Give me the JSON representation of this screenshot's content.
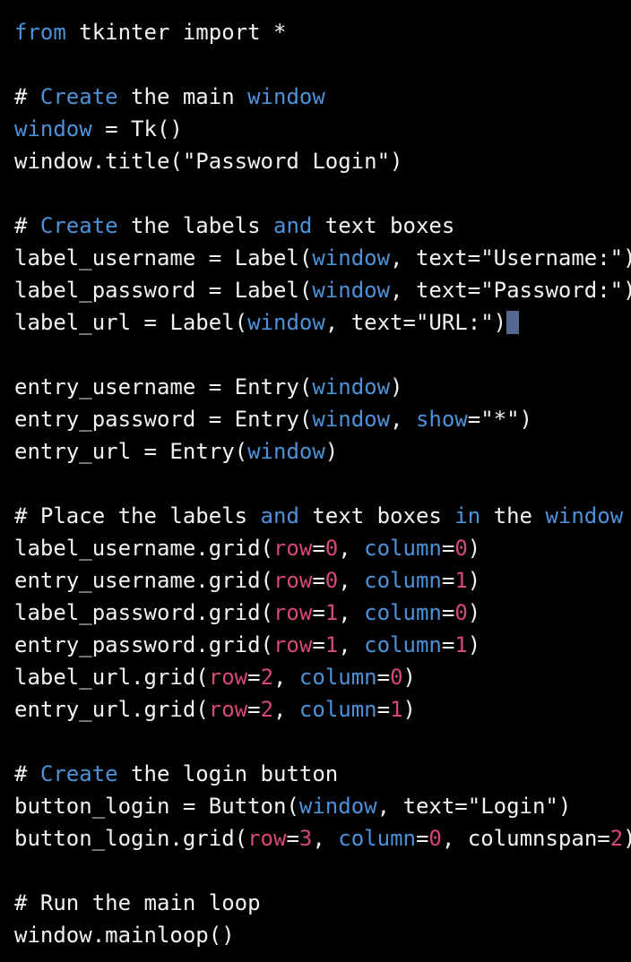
{
  "editor": {
    "background_color": "#000000",
    "font_size_px": 24,
    "line_height_px": 36,
    "colors": {
      "text": "#f2f2f2",
      "keyword_blue": "#4d92d9",
      "number_pink": "#d6477c",
      "cursor_block": "#54698d"
    },
    "language": "python",
    "cursor": {
      "line_index": 10,
      "column": 42,
      "style": "block"
    },
    "lines": [
      {
        "index": 0,
        "text": "from tkinter import *",
        "tokens": [
          {
            "t": "from",
            "c": "kw"
          },
          {
            "t": " tkinter import *",
            "c": "plain"
          }
        ]
      },
      {
        "index": 1,
        "text": "",
        "tokens": []
      },
      {
        "index": 2,
        "text": "# Create the main window",
        "tokens": [
          {
            "t": "# ",
            "c": "comment"
          },
          {
            "t": "Create",
            "c": "kw"
          },
          {
            "t": " the main ",
            "c": "comment"
          },
          {
            "t": "window",
            "c": "kw"
          }
        ]
      },
      {
        "index": 3,
        "text": "window = Tk()",
        "tokens": [
          {
            "t": "window",
            "c": "kw"
          },
          {
            "t": " = Tk()",
            "c": "plain"
          }
        ]
      },
      {
        "index": 4,
        "text": "window.title(\"Password Login\")",
        "tokens": [
          {
            "t": "window.title(\"Password Login\")",
            "c": "plain"
          }
        ]
      },
      {
        "index": 5,
        "text": "",
        "tokens": []
      },
      {
        "index": 6,
        "text": "# Create the labels and text boxes",
        "tokens": [
          {
            "t": "# ",
            "c": "comment"
          },
          {
            "t": "Create",
            "c": "kw"
          },
          {
            "t": " the labels ",
            "c": "comment"
          },
          {
            "t": "and",
            "c": "kw"
          },
          {
            "t": " text boxes",
            "c": "comment"
          }
        ]
      },
      {
        "index": 7,
        "text": "label_username = Label(window, text=\"Username:\")",
        "tokens": [
          {
            "t": "label_username = Label(",
            "c": "plain"
          },
          {
            "t": "window",
            "c": "kw"
          },
          {
            "t": ", text=\"Username:\")",
            "c": "plain"
          }
        ]
      },
      {
        "index": 8,
        "text": "label_password = Label(window, text=\"Password:\")",
        "tokens": [
          {
            "t": "label_password = Label(",
            "c": "plain"
          },
          {
            "t": "window",
            "c": "kw"
          },
          {
            "t": ", text=\"Password:\")",
            "c": "plain"
          }
        ]
      },
      {
        "index": 9,
        "text": "label_url = Label(window, text=\"URL:\")",
        "tokens": [
          {
            "t": "label_url = Label(",
            "c": "plain"
          },
          {
            "t": "window",
            "c": "kw"
          },
          {
            "t": ", text=\"URL:\")",
            "c": "plain"
          },
          {
            "t": " ",
            "c": "cursor"
          }
        ]
      },
      {
        "index": 10,
        "text": "",
        "tokens": []
      },
      {
        "index": 11,
        "text": "entry_username = Entry(window)",
        "tokens": [
          {
            "t": "entry_username = Entry(",
            "c": "plain"
          },
          {
            "t": "window",
            "c": "kw"
          },
          {
            "t": ")",
            "c": "plain"
          }
        ]
      },
      {
        "index": 12,
        "text": "entry_password = Entry(window, show=\"*\")",
        "tokens": [
          {
            "t": "entry_password = Entry(",
            "c": "plain"
          },
          {
            "t": "window",
            "c": "kw"
          },
          {
            "t": ", ",
            "c": "plain"
          },
          {
            "t": "show",
            "c": "kw"
          },
          {
            "t": "=\"*\")",
            "c": "plain"
          }
        ]
      },
      {
        "index": 13,
        "text": "entry_url = Entry(window)",
        "tokens": [
          {
            "t": "entry_url = Entry(",
            "c": "plain"
          },
          {
            "t": "window",
            "c": "kw"
          },
          {
            "t": ")",
            "c": "plain"
          }
        ]
      },
      {
        "index": 14,
        "text": "",
        "tokens": []
      },
      {
        "index": 15,
        "text": "# Place the labels and text boxes in the window",
        "tokens": [
          {
            "t": "# Place the labels ",
            "c": "comment"
          },
          {
            "t": "and",
            "c": "kw"
          },
          {
            "t": " text boxes ",
            "c": "comment"
          },
          {
            "t": "in",
            "c": "kw"
          },
          {
            "t": " the ",
            "c": "comment"
          },
          {
            "t": "window",
            "c": "kw"
          }
        ]
      },
      {
        "index": 16,
        "text": "label_username.grid(row=0, column=0)",
        "tokens": [
          {
            "t": "label_username.grid(",
            "c": "plain"
          },
          {
            "t": "row",
            "c": "kwarg"
          },
          {
            "t": "=",
            "c": "plain"
          },
          {
            "t": "0",
            "c": "num"
          },
          {
            "t": ", ",
            "c": "plain"
          },
          {
            "t": "column",
            "c": "kw"
          },
          {
            "t": "=",
            "c": "plain"
          },
          {
            "t": "0",
            "c": "num"
          },
          {
            "t": ")",
            "c": "plain"
          }
        ]
      },
      {
        "index": 17,
        "text": "entry_username.grid(row=0, column=1)",
        "tokens": [
          {
            "t": "entry_username.grid(",
            "c": "plain"
          },
          {
            "t": "row",
            "c": "kwarg"
          },
          {
            "t": "=",
            "c": "plain"
          },
          {
            "t": "0",
            "c": "num"
          },
          {
            "t": ", ",
            "c": "plain"
          },
          {
            "t": "column",
            "c": "kw"
          },
          {
            "t": "=",
            "c": "plain"
          },
          {
            "t": "1",
            "c": "num"
          },
          {
            "t": ")",
            "c": "plain"
          }
        ]
      },
      {
        "index": 18,
        "text": "label_password.grid(row=1, column=0)",
        "tokens": [
          {
            "t": "label_password.grid(",
            "c": "plain"
          },
          {
            "t": "row",
            "c": "kwarg"
          },
          {
            "t": "=",
            "c": "plain"
          },
          {
            "t": "1",
            "c": "num"
          },
          {
            "t": ", ",
            "c": "plain"
          },
          {
            "t": "column",
            "c": "kw"
          },
          {
            "t": "=",
            "c": "plain"
          },
          {
            "t": "0",
            "c": "num"
          },
          {
            "t": ")",
            "c": "plain"
          }
        ]
      },
      {
        "index": 19,
        "text": "entry_password.grid(row=1, column=1)",
        "tokens": [
          {
            "t": "entry_password.grid(",
            "c": "plain"
          },
          {
            "t": "row",
            "c": "kwarg"
          },
          {
            "t": "=",
            "c": "plain"
          },
          {
            "t": "1",
            "c": "num"
          },
          {
            "t": ", ",
            "c": "plain"
          },
          {
            "t": "column",
            "c": "kw"
          },
          {
            "t": "=",
            "c": "plain"
          },
          {
            "t": "1",
            "c": "num"
          },
          {
            "t": ")",
            "c": "plain"
          }
        ]
      },
      {
        "index": 20,
        "text": "label_url.grid(row=2, column=0)",
        "tokens": [
          {
            "t": "label_url.grid(",
            "c": "plain"
          },
          {
            "t": "row",
            "c": "kwarg"
          },
          {
            "t": "=",
            "c": "plain"
          },
          {
            "t": "2",
            "c": "num"
          },
          {
            "t": ", ",
            "c": "plain"
          },
          {
            "t": "column",
            "c": "kw"
          },
          {
            "t": "=",
            "c": "plain"
          },
          {
            "t": "0",
            "c": "num"
          },
          {
            "t": ")",
            "c": "plain"
          }
        ]
      },
      {
        "index": 21,
        "text": "entry_url.grid(row=2, column=1)",
        "tokens": [
          {
            "t": "entry_url.grid(",
            "c": "plain"
          },
          {
            "t": "row",
            "c": "kwarg"
          },
          {
            "t": "=",
            "c": "plain"
          },
          {
            "t": "2",
            "c": "num"
          },
          {
            "t": ", ",
            "c": "plain"
          },
          {
            "t": "column",
            "c": "kw"
          },
          {
            "t": "=",
            "c": "plain"
          },
          {
            "t": "1",
            "c": "num"
          },
          {
            "t": ")",
            "c": "plain"
          }
        ]
      },
      {
        "index": 22,
        "text": "",
        "tokens": []
      },
      {
        "index": 23,
        "text": "# Create the login button",
        "tokens": [
          {
            "t": "# ",
            "c": "comment"
          },
          {
            "t": "Create",
            "c": "kw"
          },
          {
            "t": " the login button",
            "c": "comment"
          }
        ]
      },
      {
        "index": 24,
        "text": "button_login = Button(window, text=\"Login\")",
        "tokens": [
          {
            "t": "button_login = Button(",
            "c": "plain"
          },
          {
            "t": "window",
            "c": "kw"
          },
          {
            "t": ", text=\"Login\")",
            "c": "plain"
          }
        ]
      },
      {
        "index": 25,
        "text": "button_login.grid(row=3, column=0, columnspan=2)",
        "tokens": [
          {
            "t": "button_login.grid(",
            "c": "plain"
          },
          {
            "t": "row",
            "c": "kwarg"
          },
          {
            "t": "=",
            "c": "plain"
          },
          {
            "t": "3",
            "c": "num"
          },
          {
            "t": ", ",
            "c": "plain"
          },
          {
            "t": "column",
            "c": "kw"
          },
          {
            "t": "=",
            "c": "plain"
          },
          {
            "t": "0",
            "c": "num"
          },
          {
            "t": ", columnspan=",
            "c": "plain"
          },
          {
            "t": "2",
            "c": "num"
          },
          {
            "t": ")",
            "c": "plain"
          }
        ]
      },
      {
        "index": 26,
        "text": "",
        "tokens": []
      },
      {
        "index": 27,
        "text": "# Run the main loop",
        "tokens": [
          {
            "t": "# Run the main loop",
            "c": "comment"
          }
        ]
      },
      {
        "index": 28,
        "text": "window.mainloop()",
        "tokens": [
          {
            "t": "window.mainloop()",
            "c": "plain"
          }
        ]
      }
    ]
  }
}
